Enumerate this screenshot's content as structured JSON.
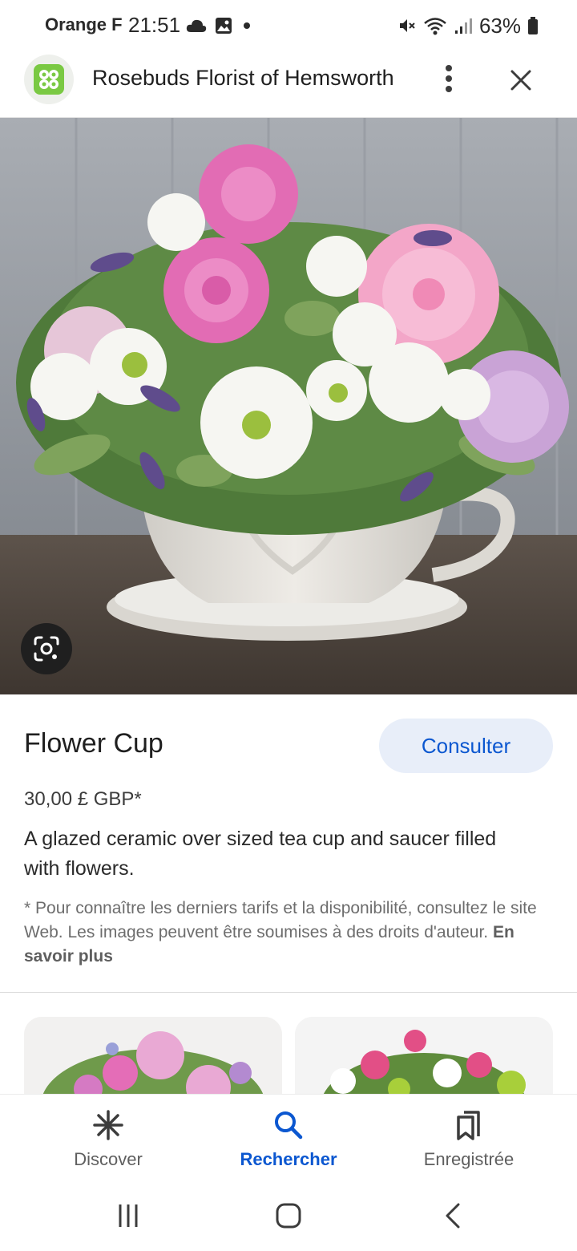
{
  "status_bar": {
    "carrier": "Orange F",
    "time": "21:51",
    "battery": "63%",
    "icons_left": [
      "cloud-icon",
      "gallery-icon",
      "dot-icon"
    ],
    "icons_right": [
      "mute-icon",
      "wifi-icon",
      "signal-icon",
      "battery-icon"
    ]
  },
  "app_bar": {
    "site_title": "Rosebuds Florist of Hemsworth",
    "favicon_color": "#7ac943",
    "icons": [
      "more-vert-icon",
      "close-icon"
    ]
  },
  "hero": {
    "lens_icon": "lens-icon"
  },
  "product": {
    "title": "Flower Cup",
    "action_label": "Consulter",
    "price": "30,00 £ GBP*",
    "description": "A glazed ceramic over sized tea cup and saucer filled with flowers.",
    "disclaimer": "* Pour connaître les derniers tarifs et la disponibilité, consultez le site Web. Les images peuvent être soumises à des droits d'auteur.",
    "learn_more": "En savoir plus"
  },
  "bottom_nav": {
    "items": [
      {
        "label": "Discover",
        "icon": "asterisk-icon",
        "active": false
      },
      {
        "label": "Rechercher",
        "icon": "search-icon",
        "active": true
      },
      {
        "label": "Enregistrée",
        "icon": "bookmarks-icon",
        "active": false
      }
    ]
  },
  "system_nav": {
    "icons": [
      "recents-icon",
      "home-icon",
      "back-icon"
    ]
  },
  "colors": {
    "accent": "#0b57d0",
    "button_bg": "#e8eef9",
    "text": "#1f1f1f"
  }
}
